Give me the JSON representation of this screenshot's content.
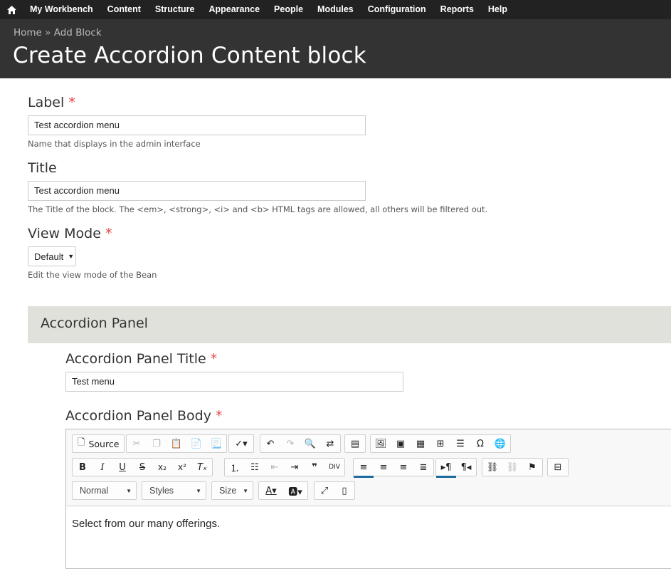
{
  "topbar": {
    "items": [
      "My Workbench",
      "Content",
      "Structure",
      "Appearance",
      "People",
      "Modules",
      "Configuration",
      "Reports",
      "Help"
    ]
  },
  "header": {
    "breadcrumb": {
      "home": "Home",
      "separator": "»",
      "current": "Add Block"
    },
    "title": "Create Accordion Content block"
  },
  "form": {
    "required_marker": "*",
    "label": {
      "label": "Label",
      "value": "Test accordion menu",
      "description": "Name that displays in the admin interface"
    },
    "title": {
      "label": "Title",
      "value": "Test accordion menu",
      "description": "The Title of the block. The <em>, <strong>, <i> and <b> HTML tags are allowed, all others will be filtered out."
    },
    "view_mode": {
      "label": "View Mode",
      "selected": "Default",
      "description": "Edit the view mode of the Bean"
    }
  },
  "panel": {
    "heading": "Accordion Panel",
    "panel_title": {
      "label": "Accordion Panel Title",
      "value": "Test menu"
    },
    "panel_body": {
      "label": "Accordion Panel Body",
      "content": "Select from our many offerings."
    }
  },
  "editor": {
    "source_label": "Source",
    "format_combo": "Normal",
    "styles_combo": "Styles",
    "size_combo": "Size",
    "accent_color": "#1f6aa1",
    "icons": {
      "row1": [
        "source-icon",
        "cut-icon",
        "copy-icon",
        "paste-icon",
        "paste-text-icon",
        "paste-word-icon",
        "spellcheck-icon",
        "undo-icon",
        "redo-icon",
        "find-icon",
        "replace-icon",
        "template-icon",
        "image-icon",
        "image2-icon",
        "media-icon",
        "table-icon",
        "horizontal-rule-icon",
        "special-char-icon",
        "iframe-icon"
      ],
      "row2": [
        "bold-icon",
        "italic-icon",
        "underline-icon",
        "strike-icon",
        "subscript-icon",
        "superscript-icon",
        "remove-format-icon",
        "numbered-list-icon",
        "bulleted-list-icon",
        "outdent-icon",
        "indent-icon",
        "blockquote-icon",
        "div-icon",
        "align-left-icon",
        "align-center-icon",
        "align-right-icon",
        "justify-icon",
        "ltr-icon",
        "rtl-icon",
        "link-icon",
        "unlink-icon",
        "anchor-icon",
        "page-break-icon"
      ],
      "row3": [
        "text-color-icon",
        "background-color-icon",
        "maximize-icon",
        "show-blocks-icon"
      ]
    }
  }
}
